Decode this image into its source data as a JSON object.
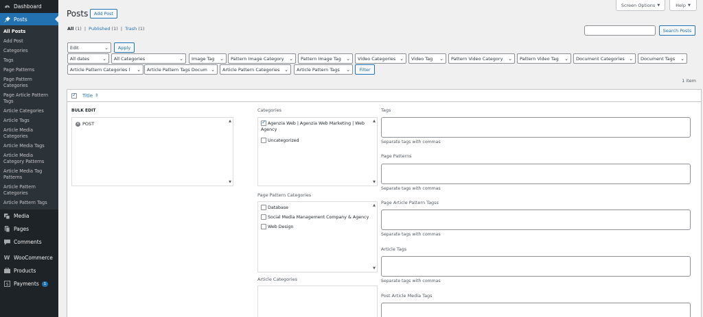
{
  "sidebar": {
    "top": [
      {
        "label": "Dashboard",
        "icon": "dashboard-icon"
      },
      {
        "label": "Posts",
        "icon": "pin-icon"
      }
    ],
    "sub": [
      "All Posts",
      "Add Post",
      "Categories",
      "Tags",
      "Page Patterns",
      "Page Pattern Categories",
      "Page Article Pattern Tags",
      "Article Categories",
      "Article Tags",
      "Article Media Categories",
      "Article Media Tags",
      "Article Media Category Patterns",
      "Article Media Tag Patterns",
      "Article Pattern Categories",
      "Article Pattern Tags"
    ],
    "bottom": [
      {
        "label": "Media",
        "icon": "media-icon"
      },
      {
        "label": "Pages",
        "icon": "pages-icon"
      },
      {
        "label": "Comments",
        "icon": "comments-icon"
      },
      {
        "label": "WooCommerce",
        "icon": "woocommerce-icon"
      },
      {
        "label": "Products",
        "icon": "products-icon"
      },
      {
        "label": "Payments",
        "icon": "payments-icon",
        "badge": "1"
      }
    ]
  },
  "header": {
    "title": "Posts",
    "add_new": "Add Post",
    "screen_options": "Screen Options",
    "help": "Help"
  },
  "views": {
    "all": "All",
    "all_count": "(1)",
    "published": "Published",
    "published_count": "(1)",
    "trash": "Trash",
    "trash_count": "(1)",
    "sep": "|"
  },
  "search": {
    "button": "Search Posts",
    "value": ""
  },
  "bulk": {
    "action": "Edit",
    "apply": "Apply"
  },
  "filters": [
    "All dates",
    "All Categories",
    "Image Tag",
    "Pattern Image Category",
    "Pattern Image Tag",
    "Video Categories",
    "Video Tag",
    "Pattern Video Category",
    "Pattern Video Tag",
    "Document Categories",
    "Document Tags",
    "Article Pattern Categories l",
    "Article Pattern Tags Docum",
    "Article Pattern Categories",
    "Article Pattern Tags"
  ],
  "filter_button": "Filter",
  "item_count": "1 item",
  "table": {
    "title_col": "Title",
    "sort_icon": "⇕"
  },
  "bulk_edit": {
    "heading": "BULK EDIT",
    "post": "POST",
    "categories_label": "Categories",
    "categories": [
      {
        "label": "Agenzia Web | Agenzia Web Marketing | Web Agency",
        "checked": true
      },
      {
        "label": "Uncategorized",
        "checked": false
      }
    ],
    "page_pattern_categories_label": "Page Pattern Categories",
    "page_pattern_categories": [
      {
        "label": "Database",
        "checked": false
      },
      {
        "label": "Social Media Management Company & Agency",
        "checked": false
      },
      {
        "label": "Web Design",
        "checked": false
      }
    ],
    "article_categories_label": "Article Categories",
    "tags_label": "Tags",
    "page_patterns_label": "Page Patterns",
    "page_article_pattern_tags_label": "Page Article Pattern Tagss",
    "article_tags_label": "Article Tags",
    "post_article_media_tags_label": "Post Article Media Tags",
    "help": "Separate tags with commas"
  }
}
